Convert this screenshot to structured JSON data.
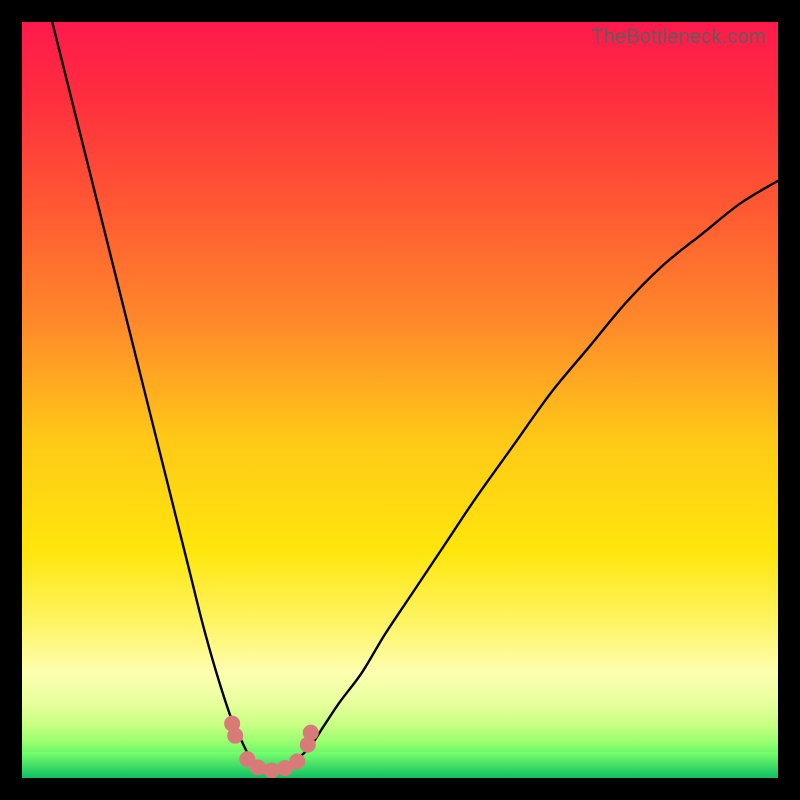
{
  "watermark": "TheBottleneck.com",
  "colors": {
    "frame": "#000000",
    "curve": "#000000",
    "marker_fill": "#d77a78",
    "marker_stroke": "#d77a78",
    "gradient_stops": [
      {
        "offset": 0.0,
        "color": "#ff1a4d"
      },
      {
        "offset": 0.1,
        "color": "#ff2e3f"
      },
      {
        "offset": 0.25,
        "color": "#ff5a32"
      },
      {
        "offset": 0.4,
        "color": "#ff8a2a"
      },
      {
        "offset": 0.55,
        "color": "#ffc817"
      },
      {
        "offset": 0.7,
        "color": "#ffe60c"
      },
      {
        "offset": 0.8,
        "color": "#fff56a"
      },
      {
        "offset": 0.86,
        "color": "#fdffb0"
      },
      {
        "offset": 0.9,
        "color": "#e8ff9e"
      },
      {
        "offset": 0.93,
        "color": "#c8ff84"
      },
      {
        "offset": 0.955,
        "color": "#93ff6d"
      },
      {
        "offset": 0.975,
        "color": "#4ef06a"
      },
      {
        "offset": 0.99,
        "color": "#1fd968"
      },
      {
        "offset": 1.0,
        "color": "#0fc862"
      }
    ],
    "green_band_top": "#7bff6d",
    "green_band_bottom": "#0dc060"
  },
  "chart_data": {
    "type": "line",
    "title": "",
    "xlabel": "",
    "ylabel": "",
    "xlim": [
      0,
      100
    ],
    "ylim": [
      0,
      100
    ],
    "series": [
      {
        "name": "bottleneck-curve",
        "x": [
          4,
          6,
          8,
          10,
          12,
          14,
          16,
          18,
          20,
          22,
          24,
          26,
          28,
          29,
          30,
          31,
          32,
          33,
          34,
          35,
          36,
          38,
          40,
          42,
          45,
          48,
          52,
          56,
          60,
          65,
          70,
          75,
          80,
          85,
          90,
          95,
          100
        ],
        "y": [
          100,
          92,
          84,
          76,
          68,
          60,
          52,
          44,
          36,
          28,
          20,
          13,
          7,
          5,
          3,
          2,
          1.5,
          1.2,
          1.2,
          1.5,
          2.2,
          4,
          7,
          10,
          14,
          19,
          25,
          31,
          37,
          44,
          51,
          57,
          63,
          68,
          72,
          76,
          79
        ]
      }
    ],
    "markers": {
      "name": "highlighted-points",
      "x": [
        27.8,
        28.2,
        29.8,
        31.2,
        33.0,
        34.8,
        36.4,
        37.8,
        38.2
      ],
      "y": [
        7.2,
        5.6,
        2.5,
        1.4,
        1.0,
        1.3,
        2.2,
        4.4,
        6.0
      ]
    }
  }
}
